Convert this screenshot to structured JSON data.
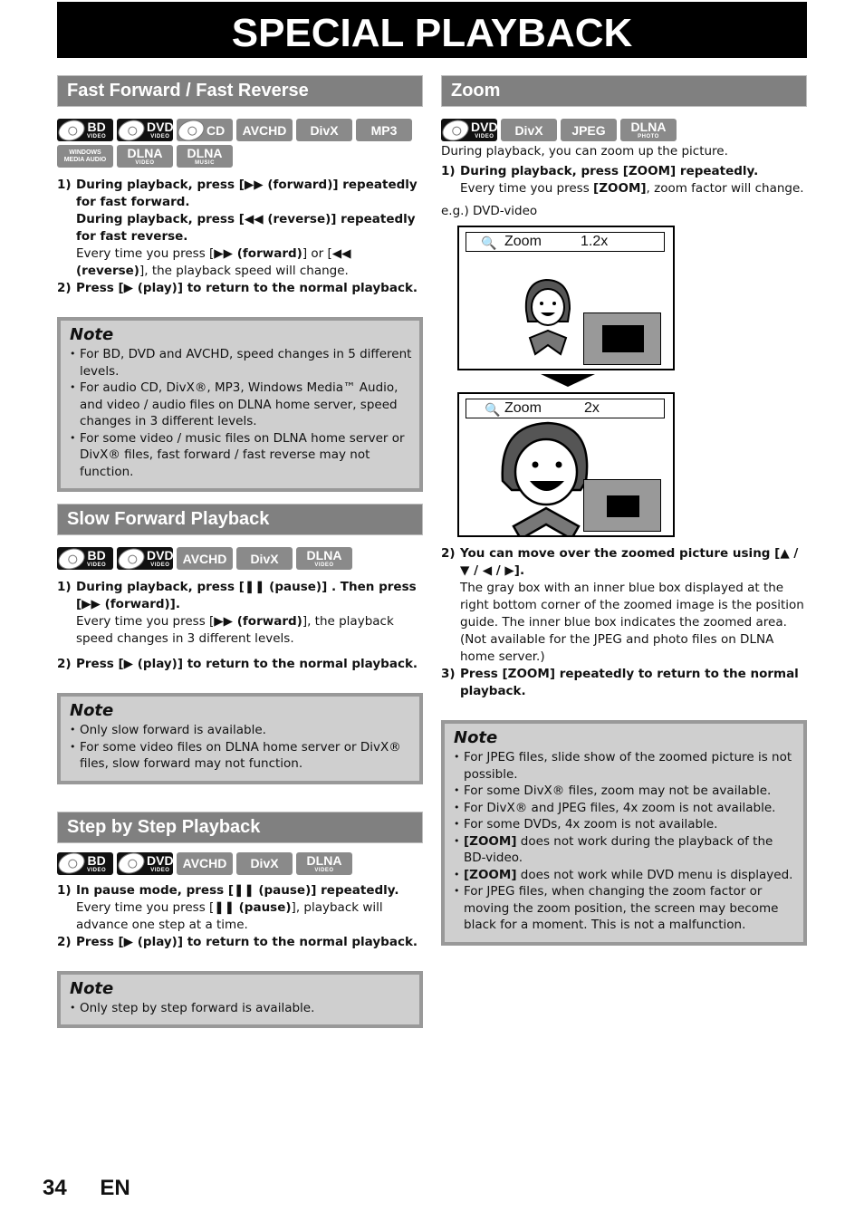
{
  "page_title": "SPECIAL PLAYBACK",
  "footer": {
    "page_number": "34",
    "language": "EN"
  },
  "sections": {
    "fast": {
      "heading": "Fast Forward / Fast Reverse",
      "badges": [
        {
          "main": "BD",
          "sub": "VIDEO",
          "dark": true
        },
        {
          "main": "DVD",
          "sub": "VIDEO",
          "dark": true
        },
        {
          "main": "CD",
          "sub": "",
          "disc": true
        },
        {
          "main": "AVCHD",
          "sub": ""
        },
        {
          "main": "DivX",
          "sub": ""
        },
        {
          "main": "MP3",
          "sub": ""
        },
        {
          "main": "WINDOWS MEDIA AUDIO",
          "sub": ""
        },
        {
          "main": "DLNA",
          "sub": "VIDEO"
        },
        {
          "main": "DLNA",
          "sub": "MUSIC"
        }
      ],
      "steps": [
        {
          "num": "1)",
          "bold1": "During playback, press [▶▶ (forward)] repeatedly for fast forward.",
          "bold2": "During playback, press [◀◀ (reverse)] repeatedly for fast reverse.",
          "text_pre": "Every time you press [",
          "text_b1": "▶▶ (forward)",
          "text_mid": "] or [",
          "text_b2": "◀◀ (reverse)",
          "text_post": "], the playback speed will change."
        },
        {
          "num": "2)",
          "bold": "Press [▶ (play)] to return to the normal playback."
        }
      ],
      "note": {
        "title": "Note",
        "items": [
          "For BD, DVD and AVCHD, speed changes in 5 different levels.",
          "For audio CD, DivX®, MP3, Windows Media™ Audio, and video / audio files on DLNA home server, speed changes in 3 different levels.",
          "For some video / music files on DLNA home server or DivX® files,  fast forward / fast reverse may not function."
        ]
      }
    },
    "slow": {
      "heading": "Slow Forward Playback",
      "badges": [
        {
          "main": "BD",
          "sub": "VIDEO",
          "dark": true
        },
        {
          "main": "DVD",
          "sub": "VIDEO",
          "dark": true
        },
        {
          "main": "AVCHD",
          "sub": ""
        },
        {
          "main": "DivX",
          "sub": ""
        },
        {
          "main": "DLNA",
          "sub": "VIDEO"
        }
      ],
      "steps": [
        {
          "num": "1)",
          "bold": "During playback, press [❚❚ (pause)] . Then press [▶▶ (forward)].",
          "text_pre": "Every time you press [",
          "text_b1": "▶▶ (forward)",
          "text_post": "], the playback speed changes in 3 different levels."
        },
        {
          "num": "2)",
          "bold": "Press [▶ (play)] to return to the normal playback."
        }
      ],
      "note": {
        "title": "Note",
        "items": [
          "Only slow forward is available.",
          "For some video files on DLNA home server or DivX® files, slow forward may not function."
        ]
      }
    },
    "step": {
      "heading": "Step by Step Playback",
      "badges": [
        {
          "main": "BD",
          "sub": "VIDEO",
          "dark": true
        },
        {
          "main": "DVD",
          "sub": "VIDEO",
          "dark": true
        },
        {
          "main": "AVCHD",
          "sub": ""
        },
        {
          "main": "DivX",
          "sub": ""
        },
        {
          "main": "DLNA",
          "sub": "VIDEO"
        }
      ],
      "steps": [
        {
          "num": "1)",
          "bold": "In pause mode, press [❚❚ (pause)] repeatedly.",
          "text_pre": "Every time you press [",
          "text_b1": "❚❚ (pause)",
          "text_post": "], playback will advance one step at a time."
        },
        {
          "num": "2)",
          "bold": "Press [▶ (play)] to return to the normal playback."
        }
      ],
      "note": {
        "title": "Note",
        "items": [
          "Only step by step forward is available."
        ]
      }
    },
    "zoom": {
      "heading": "Zoom",
      "badges": [
        {
          "main": "DVD",
          "sub": "VIDEO",
          "dark": true
        },
        {
          "main": "DivX",
          "sub": ""
        },
        {
          "main": "JPEG",
          "sub": ""
        },
        {
          "main": "DLNA",
          "sub": "PHOTO"
        }
      ],
      "intro": "During playback, you can zoom up the picture.",
      "step1": {
        "num": "1)",
        "bold": "During playback, press [ZOOM] repeatedly.",
        "text_pre": "Every time you press ",
        "text_b1": "[ZOOM]",
        "text_post": ", zoom factor will change."
      },
      "example_label": "e.g.) DVD-video",
      "screens": [
        {
          "label": "Zoom",
          "value": "1.2x"
        },
        {
          "label": "Zoom",
          "value": "2x"
        }
      ],
      "step2": {
        "num": "2)",
        "bold": "You can move over the zoomed picture using [▲ / ▼ / ◀ / ▶].",
        "text": "The gray box with an inner blue box displayed at the right bottom corner of the zoomed image is the position guide. The inner blue box indicates the zoomed area. (Not available for the JPEG and photo files on DLNA home server.)"
      },
      "step3": {
        "num": "3)",
        "bold": "Press [ZOOM] repeatedly to return to the normal playback."
      },
      "note": {
        "title": "Note",
        "items": [
          {
            "b": "",
            "t": "For JPEG files, slide show of the zoomed picture is not possible."
          },
          {
            "b": "",
            "t": "For some DivX® files, zoom may not be available."
          },
          {
            "b": "",
            "t": "For DivX® and JPEG files, 4x zoom is not available."
          },
          {
            "b": "",
            "t": "For some DVDs, 4x zoom is not available."
          },
          {
            "b": "[ZOOM]",
            "t": " does not work during the playback of the BD-video."
          },
          {
            "b": "[ZOOM]",
            "t": " does not work while DVD menu is displayed."
          },
          {
            "b": "",
            "t": "For JPEG files, when changing the zoom factor or moving the zoom position, the screen may become black for a moment. This is not a malfunction."
          }
        ]
      }
    }
  }
}
